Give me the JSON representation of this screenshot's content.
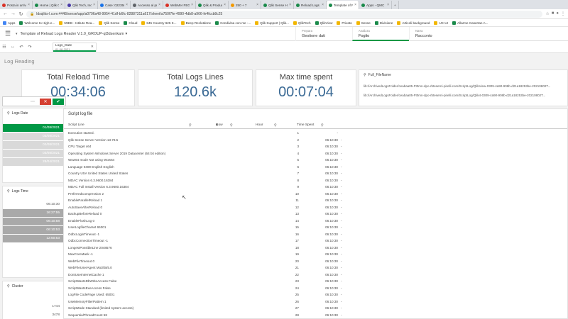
{
  "browser": {
    "tabs": [
      {
        "title": "Posta in arrivo (2)",
        "color": "#d93025"
      },
      {
        "title": "Home | Qlik Comm",
        "color": "#1a8a4a"
      },
      {
        "title": "Qlik Tech, Inc. - Pro",
        "color": "#4b3ca8"
      },
      {
        "title": "Case: 02235609",
        "color": "#1a73e8"
      },
      {
        "title": "Accesso al proprio",
        "color": "#5f6368"
      },
      {
        "title": "WebMer FEG: Accu",
        "color": "#d93025"
      },
      {
        "title": "Qlik & Product Inno",
        "color": "#1a8a4a"
      },
      {
        "title": "250 + 7",
        "color": "#f29900"
      },
      {
        "title": "Qlik Sense Hub",
        "color": "#1a8a4a"
      },
      {
        "title": "Reload Logs Rea",
        "color": "#1a8a4a"
      },
      {
        "title": "Template of Reloa",
        "color": "#1a8a4a",
        "active": true
      },
      {
        "title": "Apps - QMC",
        "color": "#1a8a4a"
      }
    ],
    "url": "ldsqliks-l.com:4448/sense/app/a0796a48-9954-41df-b6fc-82887311a617/sheet/a750f7fe-4990-4db8-a966-fe4fccb8c25",
    "bookmarks": [
      "Apps",
      "Welcome to High-e...",
      "IWEB - Istituto Rea...",
      "Qlik Sense",
      "Cloud",
      "845 Country 625 K...",
      "Deep Reclutdone",
      "Condivisa con me -...",
      "Qlik Support | Qlik...",
      "QlikTech",
      "QlikView",
      "Privato",
      "Sense",
      "Divisione",
      "Articoli background",
      "UX-UI",
      "Allarme Casertan A..."
    ]
  },
  "header": {
    "title": "Template of Reload Logs Reader V.1.0_GROUP-ql3dsenkam",
    "nav": [
      {
        "key": "Prepara",
        "value": "Gestione dati"
      },
      {
        "key": "Analizza",
        "value": "Foglio",
        "active": true
      },
      {
        "key": "Narra",
        "value": "Racconto"
      }
    ]
  },
  "selection": {
    "field": "Logs_Date",
    "value": "01-08-2021"
  },
  "sheet": {
    "title": "Log Reading"
  },
  "kpis": [
    {
      "label": "Total Reload Time",
      "value": "00:34:06"
    },
    {
      "label": "Total Logs Lines",
      "value": "120.6k"
    },
    {
      "label": "Max time spent",
      "value": "00:07:04"
    }
  ],
  "full_filename": {
    "title": "Full_FileName",
    "lines": [
      "lib://ArchivedLogsFolder/ceabaa05-Ft0mn-dpo-rbteserni-pirelli.com/ScriptLog/QlikView-0309-4a90-908b-d21a18253be-20210802T...",
      "lib://ArchivedLogsFolder/ceabaa05-Ft0mn-dpo-rbteserni-pirelli.com/ScriptLog/Qlik4-0309-4a90-908b-d21a18253be-20210802T..."
    ]
  },
  "logs_date": {
    "title": "Logs Date",
    "rows": [
      {
        "v": "01/08/2021",
        "s": "sel"
      },
      {
        "v": "03/08/2021",
        "s": "alt"
      },
      {
        "v": "02/08/2021",
        "s": "alt"
      },
      {
        "v": "03/08/2021",
        "s": "alt"
      },
      {
        "v": "28/04/2021",
        "s": "alt"
      }
    ]
  },
  "logs_time": {
    "title": "Logs Time",
    "rows": [
      {
        "v": "06:10:30",
        "s": "plain"
      },
      {
        "v": "16:27:55",
        "s": "exc"
      },
      {
        "v": "06:10:58",
        "s": "exc"
      },
      {
        "v": "06:10:53",
        "s": "exc"
      },
      {
        "v": "12:50:53",
        "s": "exc"
      }
    ]
  },
  "cluster": {
    "title": "Cluster",
    "rows": [
      {
        "v": "1744",
        "s": "plain"
      },
      {
        "v": "3478",
        "s": "plain"
      }
    ]
  },
  "log_table": {
    "title": "Script log file",
    "columns": [
      "Script Line",
      "Row",
      "Hour",
      "Time Spent"
    ],
    "rows": [
      [
        "Execution started.",
        "1",
        "-",
        ""
      ],
      [
        "Qlik Sense Server Version 13.78.5",
        "2",
        "06:10:30",
        "-"
      ],
      [
        "CPU Target x64",
        "3",
        "06:10:30",
        "-"
      ],
      [
        "Operating System Windows Server 2019 Datacenter (64 bit edition)",
        "4",
        "06:10:30",
        "-"
      ],
      [
        "Wow64 mode Not using Wow64",
        "5",
        "06:10:30",
        "-"
      ],
      [
        "Language 0409 English English",
        "6",
        "06:10:30",
        "-"
      ],
      [
        "Country USA United States United States",
        "7",
        "06:10:30",
        "-"
      ],
      [
        "MDAC Version 6.3.9600.16384",
        "8",
        "06:10:30",
        "-"
      ],
      [
        "MDAC Full Install Version 6.3.9600.16384",
        "9",
        "06:10:30",
        "-"
      ],
      [
        "PreferredCompression 2",
        "10",
        "06:10:30",
        "-"
      ],
      [
        "EnableParallelReload 1",
        "11",
        "06:10:30",
        "-"
      ],
      [
        "AutoSaveAfterReload 0",
        "12",
        "06:10:30",
        "-"
      ],
      [
        "BackupBeforeReload 0",
        "13",
        "06:10:30",
        "-"
      ],
      [
        "EnableFlushLog 0",
        "14",
        "06:10:30",
        "-"
      ],
      [
        "UserLogfileCharset 65001",
        "15",
        "06:10:30",
        "-"
      ],
      [
        "OdbcLoginTimeout -1",
        "16",
        "06:10:30",
        "-"
      ],
      [
        "OdbcConnectionTimeout -1",
        "17",
        "06:10:30",
        "-"
      ],
      [
        "LongestPossibleLine 2048576",
        "18",
        "06:10:30",
        "-"
      ],
      [
        "MaxCoreMask -1",
        "19",
        "06:10:30",
        "-"
      ],
      [
        "WebFileTimeout 0",
        "20",
        "06:10:30",
        "-"
      ],
      [
        "WebFileUserAgent Mozilla/5.0",
        "21",
        "06:10:30",
        "-"
      ],
      [
        "DontUseInternetCache 1",
        "22",
        "06:10:30",
        "-"
      ],
      [
        "ScriptWantsDbWriteAccess False",
        "23",
        "06:10:30",
        "-"
      ],
      [
        "ScriptWantsExeAccess False",
        "24",
        "06:10:30",
        "-"
      ],
      [
        "LogFile CodePage Used: 65001",
        "25",
        "06:10:30",
        "-"
      ],
      [
        "UseMemoryFilterPattern 1",
        "26",
        "06:10:30",
        "-"
      ],
      [
        "ScriptMode Standard (limited system access)",
        "27",
        "06:10:30",
        "-"
      ],
      [
        "SequentialThreadCount 58",
        "28",
        "06:10:30",
        "-"
      ]
    ]
  },
  "colors": {
    "accent_green": "#009845",
    "kpi_blue": "#3b6a95",
    "cancel_red": "#d53f31"
  },
  "icons": [
    "hamburger-menu-icon",
    "search-icon",
    "close-icon",
    "check-icon",
    "more-icon",
    "sort-icon"
  ]
}
